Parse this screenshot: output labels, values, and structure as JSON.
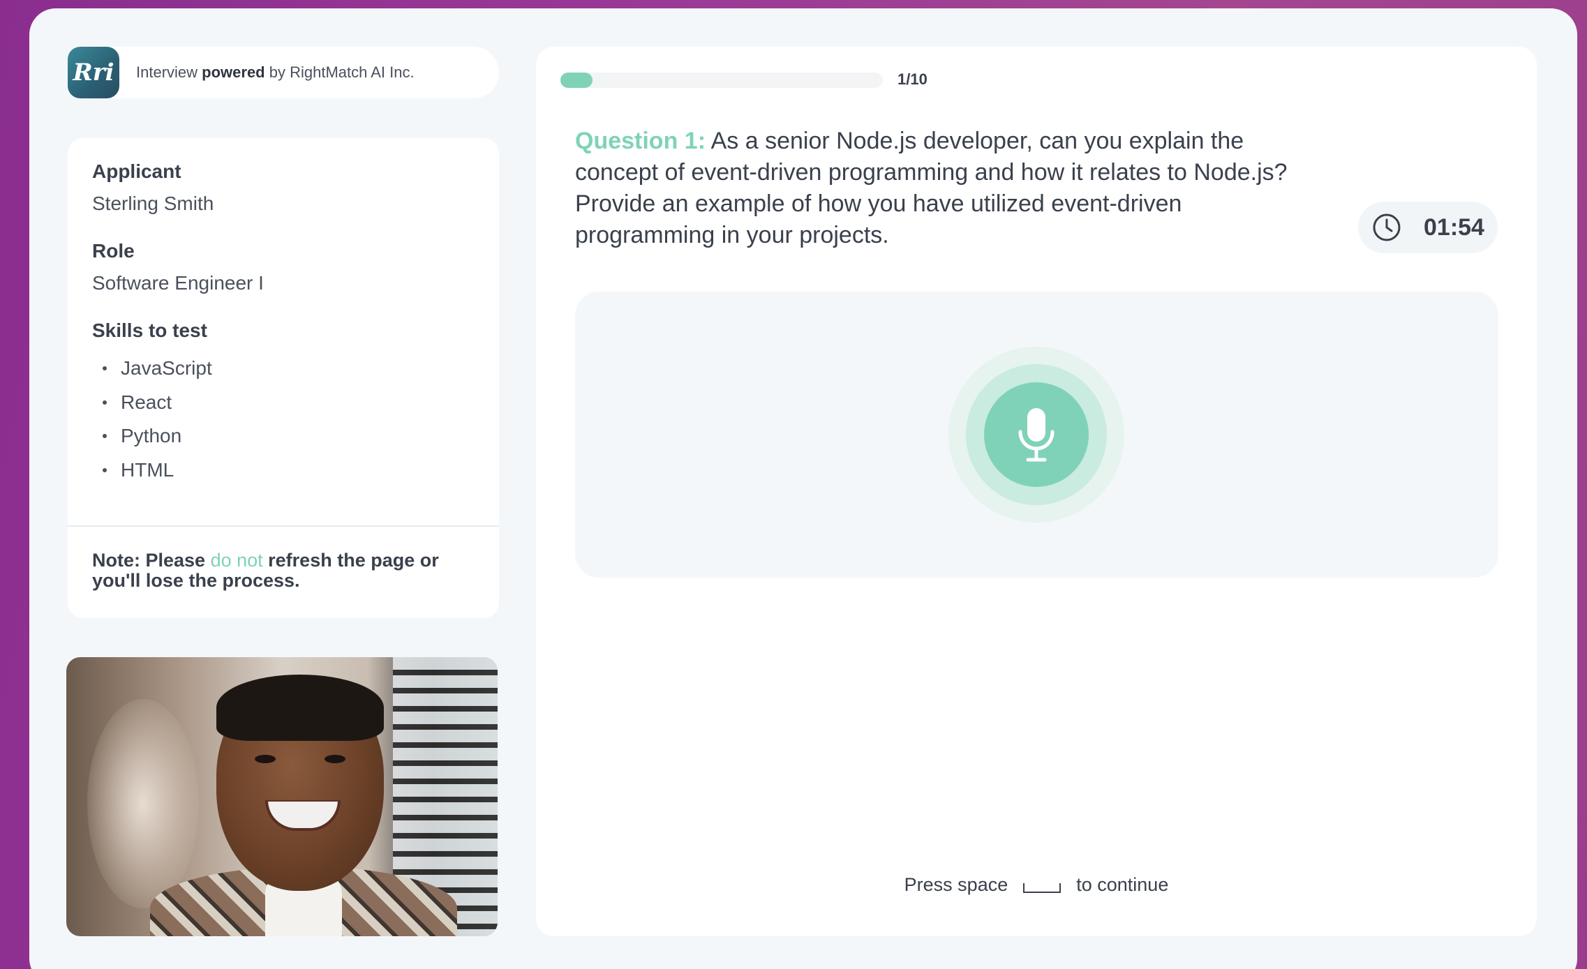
{
  "brand": {
    "logo_text": "Rri",
    "prefix": "Interview ",
    "powered": "powered",
    "suffix": " by RightMatch AI Inc."
  },
  "info": {
    "applicant_label": "Applicant",
    "applicant_name": "Sterling Smith",
    "role_label": "Role",
    "role_value": "Software Engineer I",
    "skills_label": "Skills to test",
    "skills": [
      "JavaScript",
      "React",
      "Python",
      "HTML"
    ],
    "note_prefix": "Note: Please ",
    "note_accent": "do not",
    "note_suffix": " refresh the page or you'll lose the process."
  },
  "progress": {
    "current": 1,
    "total": 10,
    "label": "1/10"
  },
  "question": {
    "label": "Question 1:",
    "text": " As a senior Node.js developer, can you explain the concept of event-driven programming and how it relates to Node.js? Provide an example of how you have utilized event-driven programming in your projects."
  },
  "timer": {
    "value": "01:54",
    "icon": "clock-icon"
  },
  "record": {
    "icon": "microphone-icon"
  },
  "hint": {
    "prefix": "Press space",
    "suffix": "to continue"
  },
  "colors": {
    "accent": "#7fd2b8",
    "background_gradient_start": "#8a2d8f",
    "panel": "#ffffff",
    "frame": "#f4f7f9"
  }
}
